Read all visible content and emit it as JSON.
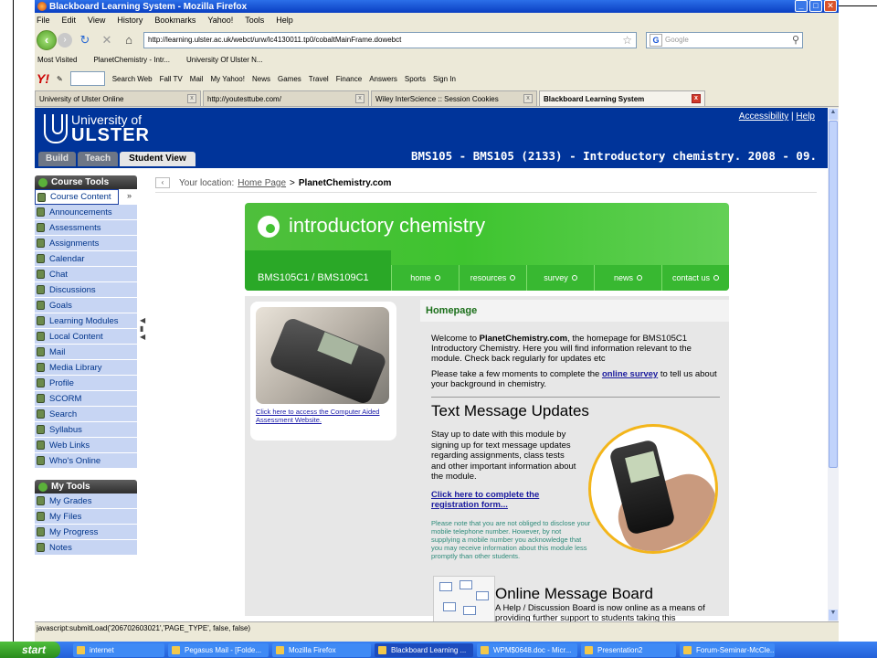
{
  "window": {
    "title": "Blackboard Learning System - Mozilla Firefox"
  },
  "menu": [
    "File",
    "Edit",
    "View",
    "History",
    "Bookmarks",
    "Yahoo!",
    "Tools",
    "Help"
  ],
  "nav": {
    "url": "http://learning.ulster.ac.uk/webct/urw/lc4130011.tp0/cobaltMainFrame.dowebct",
    "search_placeholder": "Google"
  },
  "bookmarks": [
    "Most Visited",
    "PlanetChemistry - Intr...",
    "University Of Ulster N..."
  ],
  "yahoo_toolbar": [
    "Search Web",
    "Fall TV",
    "Mail",
    "My Yahoo!",
    "News",
    "Games",
    "Travel",
    "Finance",
    "Answers",
    "Sports",
    "Sign In"
  ],
  "tabs": [
    {
      "label": "University of Ulster Online"
    },
    {
      "label": "http://youtesttube.com/"
    },
    {
      "label": "Wiley InterScience :: Session Cookies"
    },
    {
      "label": "Blackboard Learning System"
    }
  ],
  "header": {
    "logo_line1": "University of",
    "logo_line2": "ULSTER",
    "accessibility": "Accessibility",
    "help": "Help",
    "separator": "|",
    "view_tabs": [
      "Build",
      "Teach",
      "Student View"
    ],
    "course_title": "BMS105 - BMS105 (2133) - Introductory chemistry. 2008 - 09."
  },
  "course_tools": {
    "heading": "Course Tools",
    "items": [
      "Course Content",
      "Announcements",
      "Assessments",
      "Assignments",
      "Calendar",
      "Chat",
      "Discussions",
      "Goals",
      "Learning Modules",
      "Local Content",
      "Mail",
      "Media Library",
      "Profile",
      "SCORM",
      "Search",
      "Syllabus",
      "Web Links",
      "Who's Online"
    ]
  },
  "my_tools": {
    "heading": "My Tools",
    "items": [
      "My Grades",
      "My Files",
      "My Progress",
      "Notes"
    ]
  },
  "breadcrumb": {
    "label": "Your location:",
    "home": "Home Page",
    "sep": ">",
    "current": "PlanetChemistry.com"
  },
  "banner": {
    "title": "introductory chemistry",
    "code": "BMS105C1 / BMS109C1",
    "menu": [
      "home",
      "resources",
      "survey",
      "news",
      "contact us"
    ]
  },
  "left_card": {
    "link": "Click here to access the Computer Aided Assessment Website."
  },
  "homepage": {
    "heading": "Homepage",
    "welcome_pre": "Welcome to ",
    "welcome_bold": "PlanetChemistry.com",
    "welcome_post": ", the homepage for BMS105C1 Introductory Chemistry. Here you will find information relevant to the module. Check back regularly for updates etc",
    "survey_pre": "Please take a few moments to complete the ",
    "survey_link": "online survey",
    "survey_post": " to tell us about your background in chemistry.",
    "tmu_title": "Text Message Updates",
    "tmu_text": "Stay up to date with this module by signing up for text message updates regarding assignments, class tests and other important information about the module.",
    "tmu_link": "Click here to complete the registration form...",
    "tmu_note": "Please note that you are not obliged to disclose your mobile telephone number. However, by not supplying a mobile number you acknowledge that you may receive information about this module less promptly than other students.",
    "omb_title": "Online Message Board",
    "omb_text": "A Help / Discussion Board is now online as a means of providing further support to students taking this"
  },
  "status": "javascript:submitLoad('206702603021','PAGE_TYPE', false, false)",
  "taskbar": {
    "start": "start",
    "items": [
      "internet",
      "Pegasus Mail - [Folde...",
      "Mozilla Firefox",
      "Blackboard Learning ...",
      "WPM$0648.doc - Micr...",
      "Presentation2",
      "Forum-Seminar-McCle..."
    ]
  }
}
